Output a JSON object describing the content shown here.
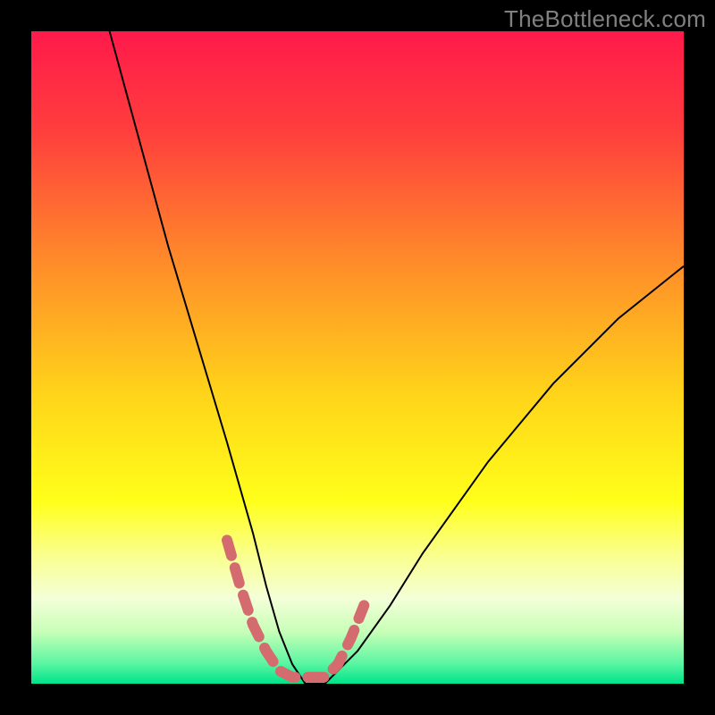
{
  "watermark": "TheBottleneck.com",
  "chart_data": {
    "type": "line",
    "title": "",
    "xlabel": "",
    "ylabel": "",
    "xlim": [
      0,
      100
    ],
    "ylim": [
      0,
      100
    ],
    "background_gradient": {
      "stops": [
        {
          "offset": 0.0,
          "color": "#ff1a4b"
        },
        {
          "offset": 0.15,
          "color": "#ff3d3d"
        },
        {
          "offset": 0.35,
          "color": "#ff8a2a"
        },
        {
          "offset": 0.55,
          "color": "#ffd21a"
        },
        {
          "offset": 0.72,
          "color": "#ffff1a"
        },
        {
          "offset": 0.8,
          "color": "#faff8a"
        },
        {
          "offset": 0.87,
          "color": "#f4ffd8"
        },
        {
          "offset": 0.92,
          "color": "#c8ffb8"
        },
        {
          "offset": 0.97,
          "color": "#58f5a2"
        },
        {
          "offset": 1.0,
          "color": "#00e28a"
        }
      ]
    },
    "series": [
      {
        "name": "bottleneck-curve",
        "color": "#000000",
        "stroke_width": 2,
        "x": [
          12,
          15,
          18,
          21,
          24,
          27,
          30,
          32,
          34,
          36,
          38,
          40,
          42,
          45,
          50,
          55,
          60,
          65,
          70,
          75,
          80,
          85,
          90,
          95,
          100
        ],
        "values": [
          100,
          89,
          78,
          67,
          57,
          47,
          37,
          30,
          23,
          15,
          8,
          3,
          0,
          0,
          5,
          12,
          20,
          27,
          34,
          40,
          46,
          51,
          56,
          60,
          64
        ]
      }
    ],
    "highlight_band": {
      "name": "optimal-range",
      "color": "#d36b6f",
      "stroke_width": 12,
      "x": [
        30,
        32,
        34,
        36,
        38,
        40,
        42,
        45,
        47,
        49,
        51
      ],
      "values": [
        22,
        15,
        9,
        5,
        2,
        1,
        1,
        1,
        3,
        7,
        12
      ]
    }
  }
}
